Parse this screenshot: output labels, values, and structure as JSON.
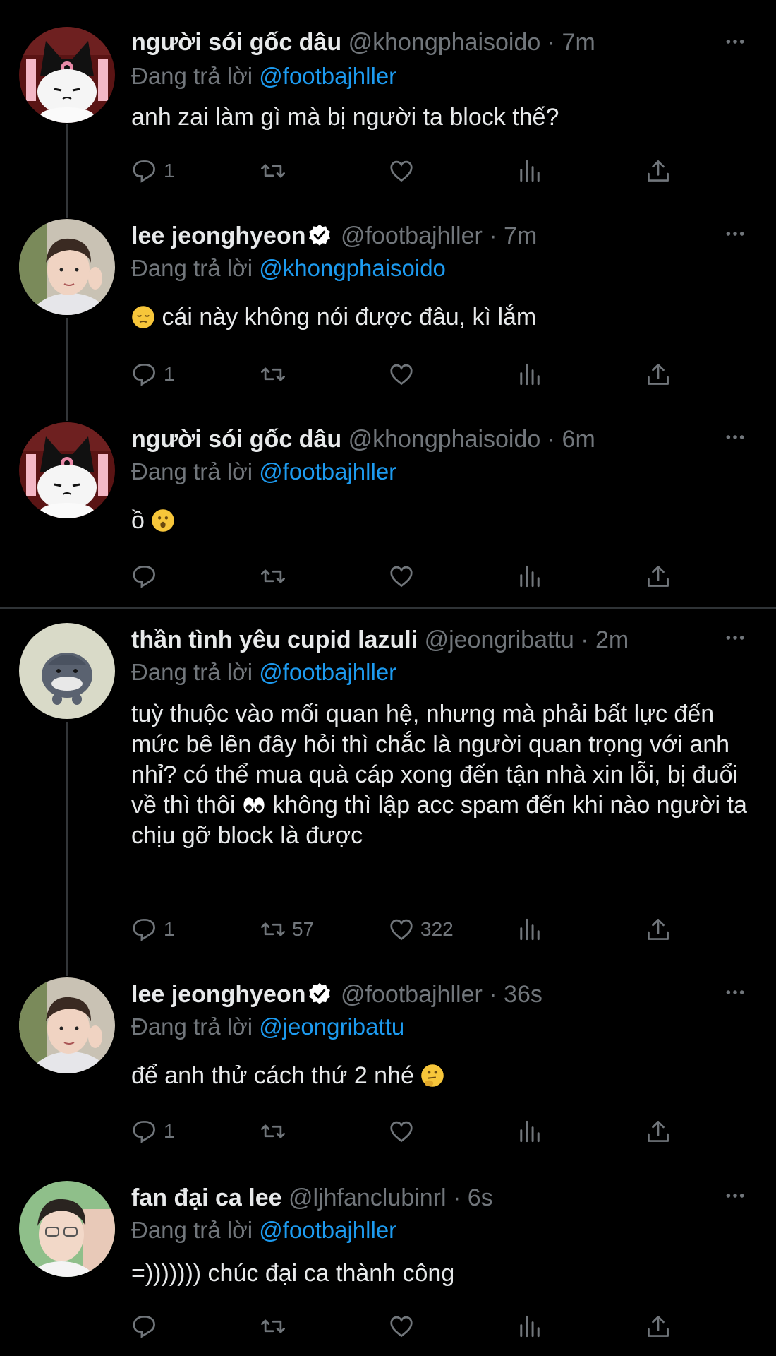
{
  "replying_prefix": "Đang trả lời",
  "tweets": [
    {
      "name": "người sói gốc dâu",
      "handle": "@khongphaisoido",
      "time": "· 7m",
      "reply_to": "@footbajhller",
      "text": "anh zai làm gì mà bị người ta block thế?",
      "replies": "1",
      "retweets": "",
      "likes": ""
    },
    {
      "name": "lee jeonghyeon",
      "handle": "@footbajhller",
      "time": "· 7m",
      "reply_to": "@khongphaisoido",
      "text": "cái này không nói được đâu, kì lắm",
      "replies": "1",
      "retweets": "",
      "likes": ""
    },
    {
      "name": "người sói gốc dâu",
      "handle": "@khongphaisoido",
      "time": "· 6m",
      "reply_to": "@footbajhller",
      "text": "ồ",
      "replies": "",
      "retweets": "",
      "likes": ""
    },
    {
      "name": "thần tình yêu cupid lazuli",
      "handle": "@jeongribattu",
      "time": "· 2m",
      "reply_to": "@footbajhller",
      "text_a": "tuỳ thuộc vào mối quan hệ, nhưng mà phải bất lực đến mức bê lên đây hỏi thì chắc là người quan trọng với anh nhỉ? có thể mua quà cáp xong đến tận nhà xin lỗi, bị đuổi về thì thôi",
      "text_b": "không thì lập acc spam đến khi nào người ta chịu gỡ block là được",
      "replies": "1",
      "retweets": "57",
      "likes": "322"
    },
    {
      "name": "lee jeonghyeon",
      "handle": "@footbajhller",
      "time": "· 36s",
      "reply_to": "@jeongribattu",
      "text": "để anh thử cách thứ 2 nhé",
      "replies": "1",
      "retweets": "",
      "likes": ""
    },
    {
      "name": "fan đại ca lee",
      "handle": "@ljhfanclubinrl",
      "time": "· 6s",
      "reply_to": "@footbajhller",
      "text": "=))))))) chúc đại ca thành công",
      "replies": "",
      "retweets": "",
      "likes": ""
    }
  ],
  "icons": {
    "reply": "reply-icon",
    "retweet": "retweet-icon",
    "like": "heart-icon",
    "views": "views-icon",
    "share": "share-icon",
    "more": "more-icon",
    "verified": "verified-badge-icon"
  },
  "colors": {
    "background": "#000000",
    "link": "#1d9bf0",
    "muted": "#71767b",
    "verified": "#ffffff"
  }
}
